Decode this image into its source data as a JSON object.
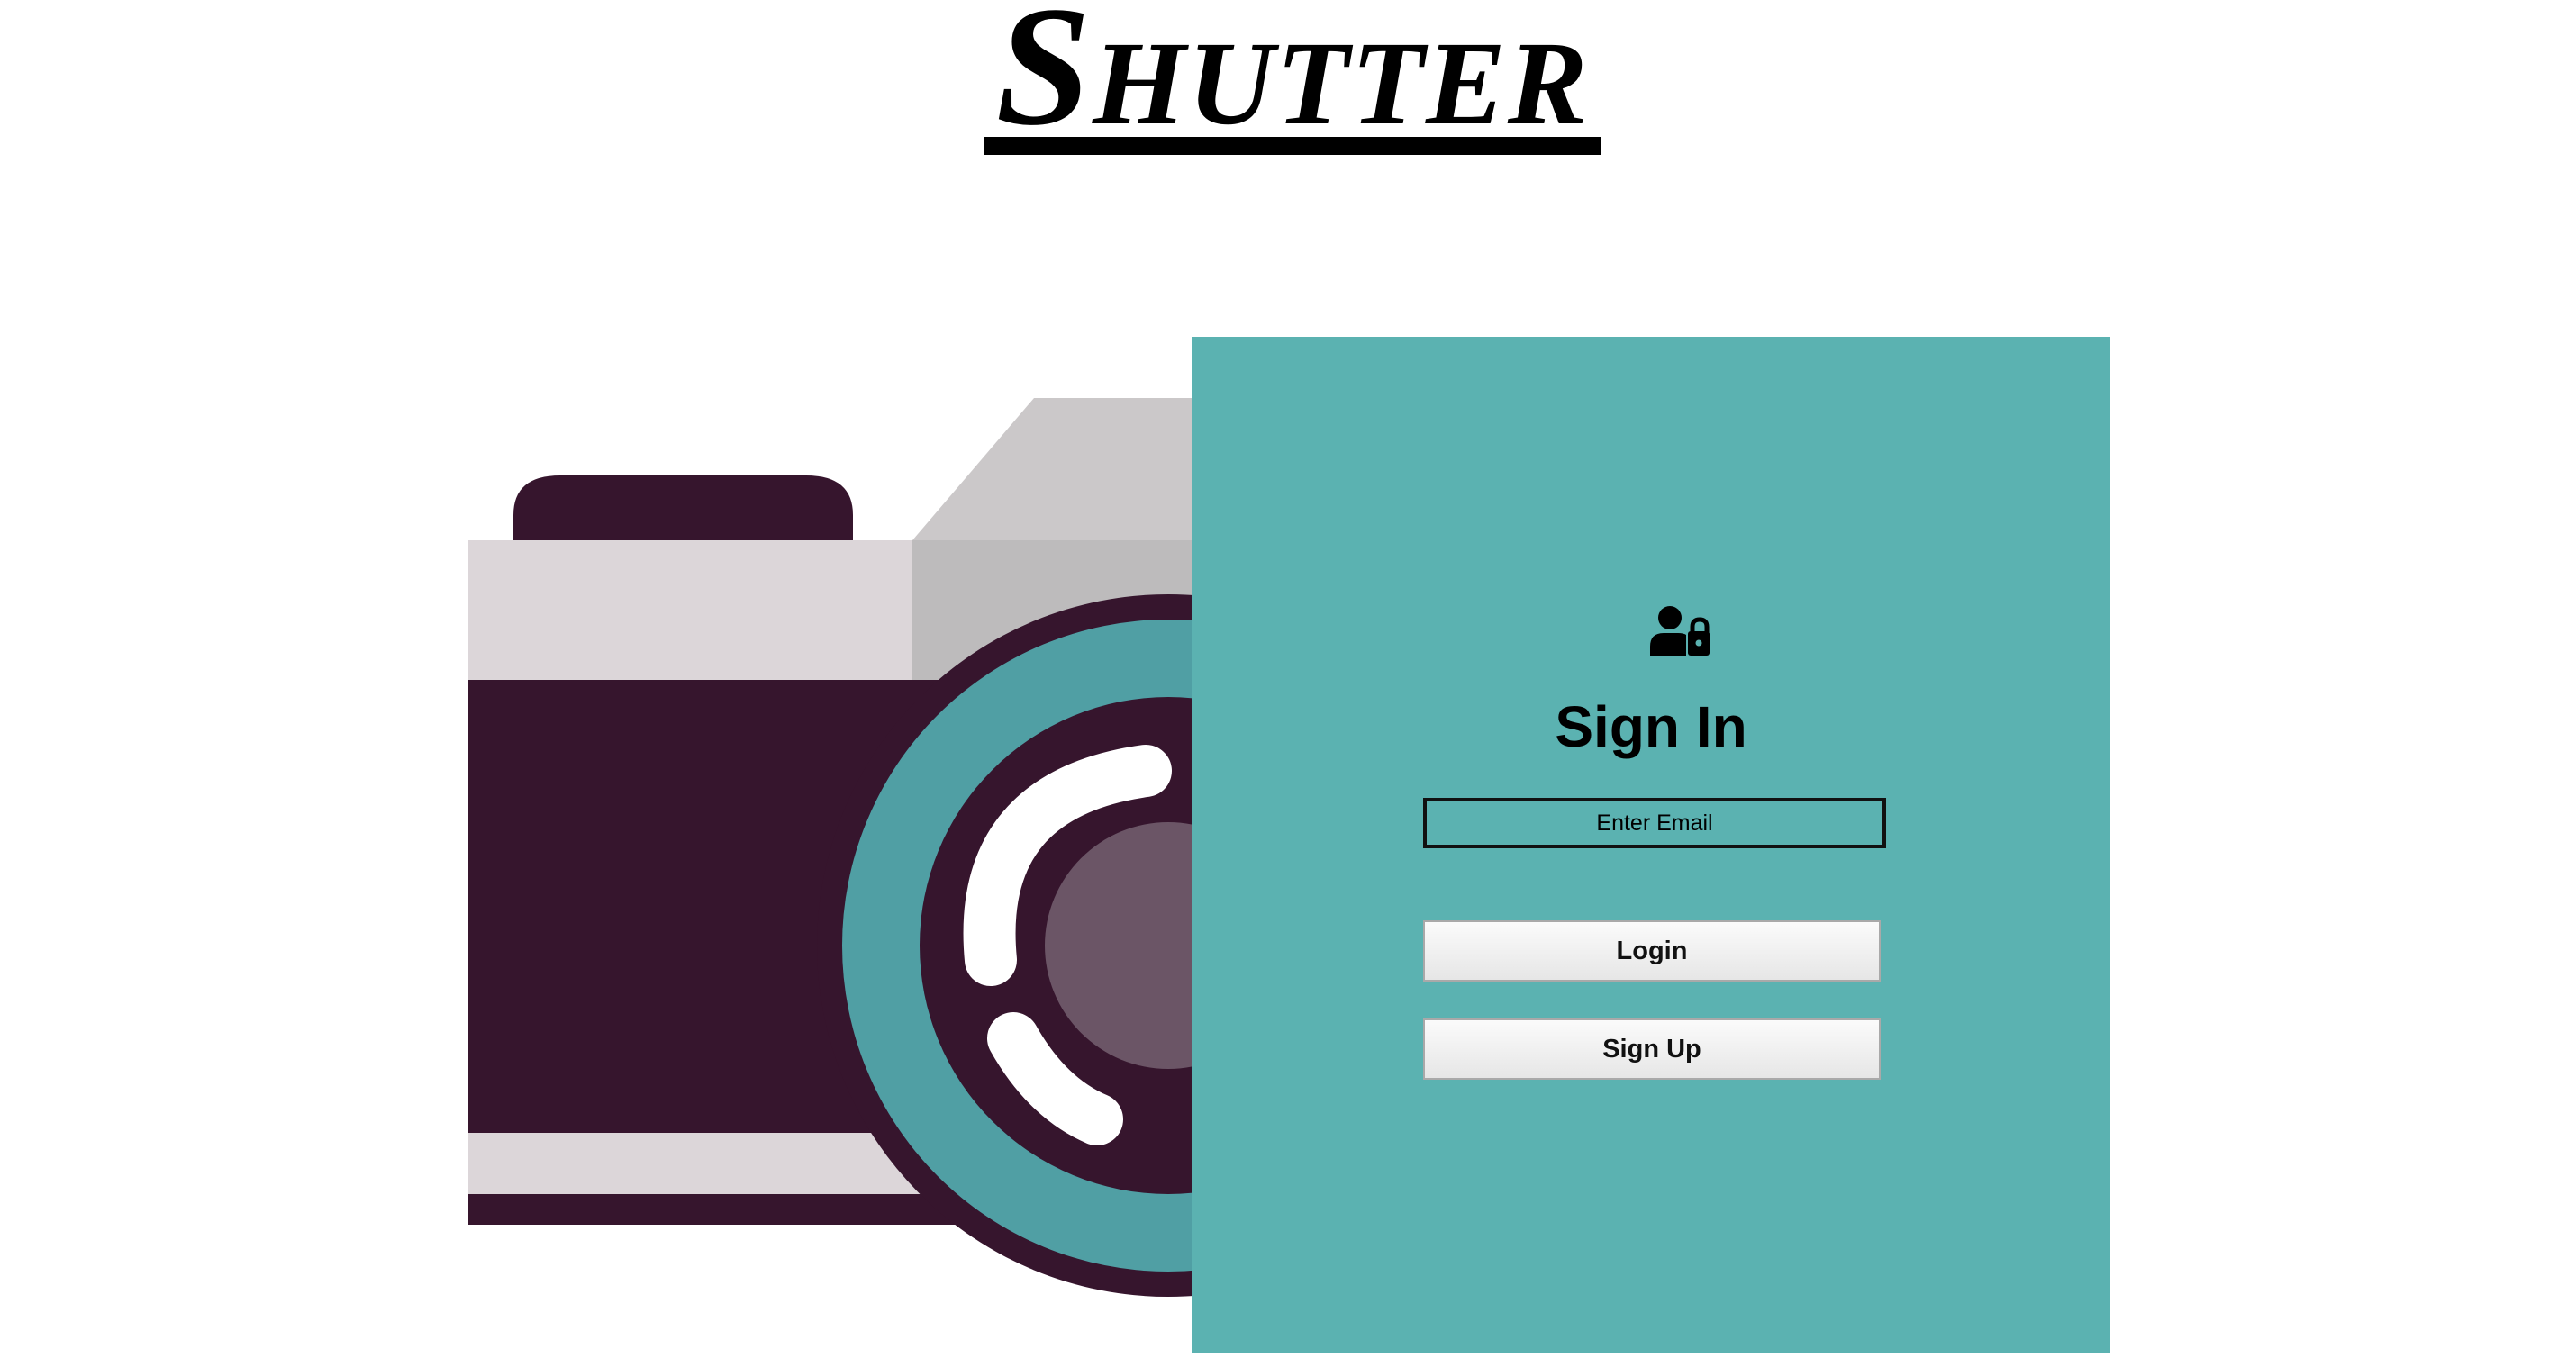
{
  "header": {
    "logo_text": "Shutter"
  },
  "colors": {
    "panel_background": "#5bb2b1",
    "camera_body": "#36152d",
    "camera_light": "#dcd6d9",
    "camera_gray": "#bdbbbc",
    "camera_top_gray": "#cbc8c9",
    "lens_teal": "#509fa4",
    "lens_center": "#6b5566"
  },
  "sign_in": {
    "icon": "user-lock-icon",
    "title": "Sign In",
    "email_placeholder": "Enter Email",
    "login_label": "Login",
    "signup_label": "Sign Up"
  },
  "illustration": {
    "icon": "camera-illustration"
  }
}
